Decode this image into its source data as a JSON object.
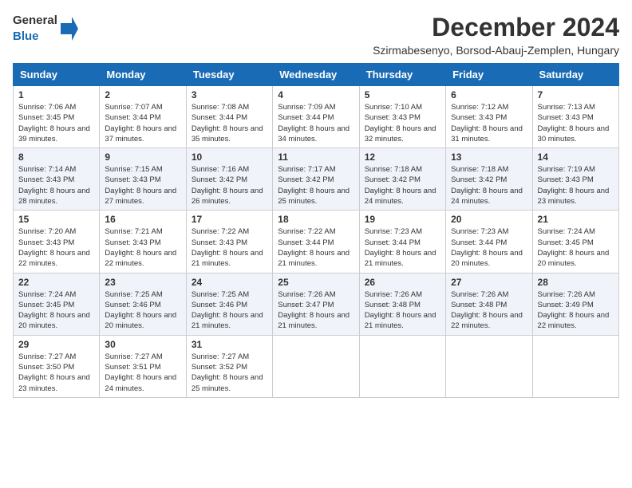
{
  "logo": {
    "line1": "General",
    "line2": "Blue"
  },
  "title": "December 2024",
  "subtitle": "Szirmabesenyo, Borsod-Abauj-Zemplen, Hungary",
  "days_of_week": [
    "Sunday",
    "Monday",
    "Tuesday",
    "Wednesday",
    "Thursday",
    "Friday",
    "Saturday"
  ],
  "weeks": [
    [
      {
        "day": 1,
        "sunrise": "7:06 AM",
        "sunset": "3:45 PM",
        "daylight": "8 hours and 39 minutes."
      },
      {
        "day": 2,
        "sunrise": "7:07 AM",
        "sunset": "3:44 PM",
        "daylight": "8 hours and 37 minutes."
      },
      {
        "day": 3,
        "sunrise": "7:08 AM",
        "sunset": "3:44 PM",
        "daylight": "8 hours and 35 minutes."
      },
      {
        "day": 4,
        "sunrise": "7:09 AM",
        "sunset": "3:44 PM",
        "daylight": "8 hours and 34 minutes."
      },
      {
        "day": 5,
        "sunrise": "7:10 AM",
        "sunset": "3:43 PM",
        "daylight": "8 hours and 32 minutes."
      },
      {
        "day": 6,
        "sunrise": "7:12 AM",
        "sunset": "3:43 PM",
        "daylight": "8 hours and 31 minutes."
      },
      {
        "day": 7,
        "sunrise": "7:13 AM",
        "sunset": "3:43 PM",
        "daylight": "8 hours and 30 minutes."
      }
    ],
    [
      {
        "day": 8,
        "sunrise": "7:14 AM",
        "sunset": "3:43 PM",
        "daylight": "8 hours and 28 minutes."
      },
      {
        "day": 9,
        "sunrise": "7:15 AM",
        "sunset": "3:43 PM",
        "daylight": "8 hours and 27 minutes."
      },
      {
        "day": 10,
        "sunrise": "7:16 AM",
        "sunset": "3:42 PM",
        "daylight": "8 hours and 26 minutes."
      },
      {
        "day": 11,
        "sunrise": "7:17 AM",
        "sunset": "3:42 PM",
        "daylight": "8 hours and 25 minutes."
      },
      {
        "day": 12,
        "sunrise": "7:18 AM",
        "sunset": "3:42 PM",
        "daylight": "8 hours and 24 minutes."
      },
      {
        "day": 13,
        "sunrise": "7:18 AM",
        "sunset": "3:42 PM",
        "daylight": "8 hours and 24 minutes."
      },
      {
        "day": 14,
        "sunrise": "7:19 AM",
        "sunset": "3:43 PM",
        "daylight": "8 hours and 23 minutes."
      }
    ],
    [
      {
        "day": 15,
        "sunrise": "7:20 AM",
        "sunset": "3:43 PM",
        "daylight": "8 hours and 22 minutes."
      },
      {
        "day": 16,
        "sunrise": "7:21 AM",
        "sunset": "3:43 PM",
        "daylight": "8 hours and 22 minutes."
      },
      {
        "day": 17,
        "sunrise": "7:22 AM",
        "sunset": "3:43 PM",
        "daylight": "8 hours and 21 minutes."
      },
      {
        "day": 18,
        "sunrise": "7:22 AM",
        "sunset": "3:44 PM",
        "daylight": "8 hours and 21 minutes."
      },
      {
        "day": 19,
        "sunrise": "7:23 AM",
        "sunset": "3:44 PM",
        "daylight": "8 hours and 21 minutes."
      },
      {
        "day": 20,
        "sunrise": "7:23 AM",
        "sunset": "3:44 PM",
        "daylight": "8 hours and 20 minutes."
      },
      {
        "day": 21,
        "sunrise": "7:24 AM",
        "sunset": "3:45 PM",
        "daylight": "8 hours and 20 minutes."
      }
    ],
    [
      {
        "day": 22,
        "sunrise": "7:24 AM",
        "sunset": "3:45 PM",
        "daylight": "8 hours and 20 minutes."
      },
      {
        "day": 23,
        "sunrise": "7:25 AM",
        "sunset": "3:46 PM",
        "daylight": "8 hours and 20 minutes."
      },
      {
        "day": 24,
        "sunrise": "7:25 AM",
        "sunset": "3:46 PM",
        "daylight": "8 hours and 21 minutes."
      },
      {
        "day": 25,
        "sunrise": "7:26 AM",
        "sunset": "3:47 PM",
        "daylight": "8 hours and 21 minutes."
      },
      {
        "day": 26,
        "sunrise": "7:26 AM",
        "sunset": "3:48 PM",
        "daylight": "8 hours and 21 minutes."
      },
      {
        "day": 27,
        "sunrise": "7:26 AM",
        "sunset": "3:48 PM",
        "daylight": "8 hours and 22 minutes."
      },
      {
        "day": 28,
        "sunrise": "7:26 AM",
        "sunset": "3:49 PM",
        "daylight": "8 hours and 22 minutes."
      }
    ],
    [
      {
        "day": 29,
        "sunrise": "7:27 AM",
        "sunset": "3:50 PM",
        "daylight": "8 hours and 23 minutes."
      },
      {
        "day": 30,
        "sunrise": "7:27 AM",
        "sunset": "3:51 PM",
        "daylight": "8 hours and 24 minutes."
      },
      {
        "day": 31,
        "sunrise": "7:27 AM",
        "sunset": "3:52 PM",
        "daylight": "8 hours and 25 minutes."
      },
      null,
      null,
      null,
      null
    ]
  ]
}
